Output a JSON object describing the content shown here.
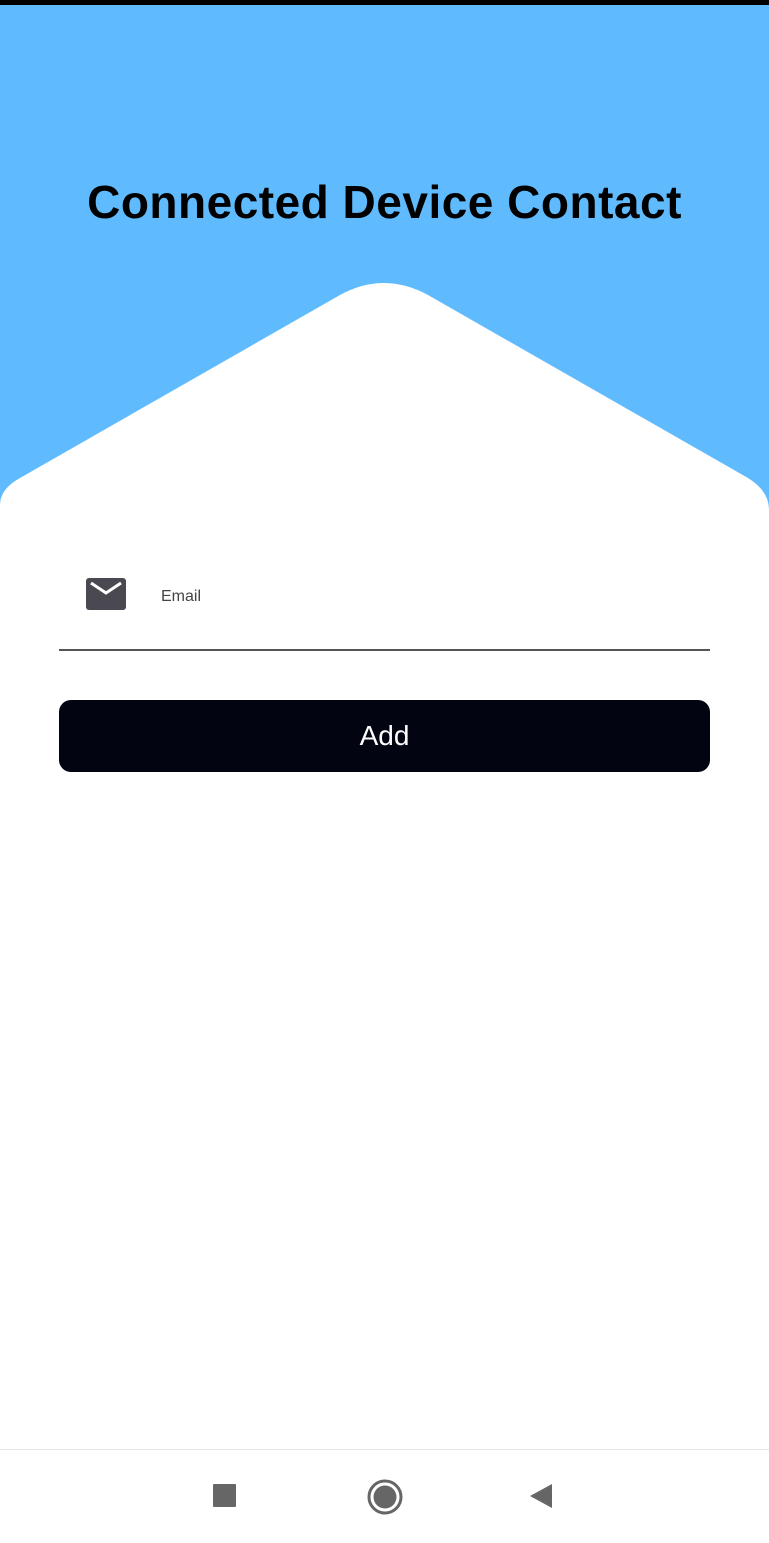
{
  "header": {
    "title": "Connected Device Contact",
    "color": "#5fbbfe"
  },
  "form": {
    "email_icon": "envelope-icon",
    "email_placeholder": "Email",
    "email_value": "",
    "add_label": "Add",
    "button_color": "#020412"
  },
  "navbar": {
    "items": [
      "recents-square-icon",
      "home-circle-icon",
      "back-triangle-icon"
    ]
  }
}
